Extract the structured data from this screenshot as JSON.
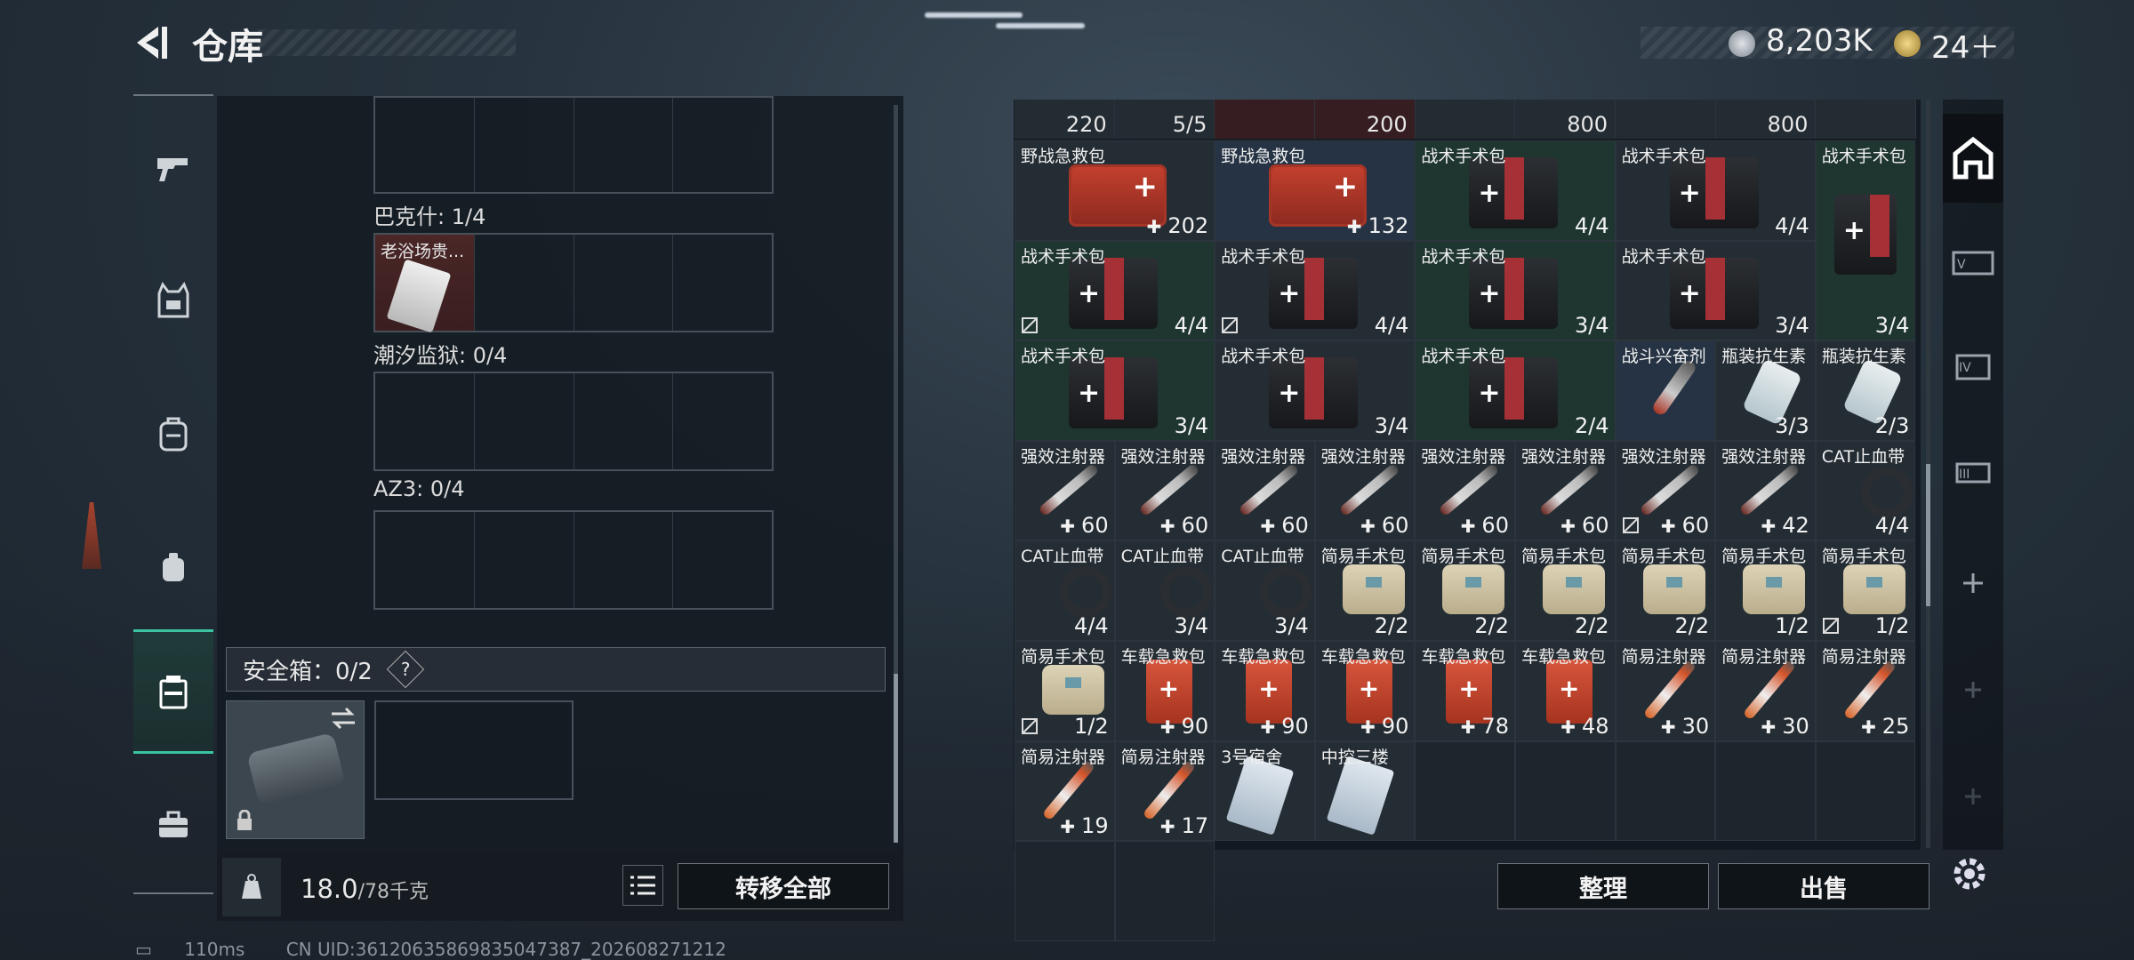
{
  "header": {
    "title": "仓库",
    "currency": "8,203K",
    "tokens": "24＋"
  },
  "left_tabs": [
    "pistol-icon",
    "vest-icon",
    "backpack-icon",
    "pouch-icon",
    "safebox-icon",
    "toolbox-icon"
  ],
  "left_sections": [
    {
      "label": "巴克什: 1/4",
      "slot_item": "老浴场贵..."
    },
    {
      "label": "潮汐监狱: 0/4"
    },
    {
      "label": "AZ3: 0/4"
    }
  ],
  "safebox": {
    "label": "安全箱：0/2",
    "help": "?"
  },
  "footer": {
    "weight": "18.0",
    "weight_max": "/78千克",
    "transfer_all": "转移全部"
  },
  "right_toprow": [
    {
      "value": "220"
    },
    {
      "value": "5/5"
    },
    {
      "value": ""
    },
    {
      "value": "200"
    },
    {
      "value": ""
    },
    {
      "value": "800"
    },
    {
      "value": ""
    },
    {
      "value": "800"
    },
    {
      "value": ""
    }
  ],
  "right_buttons": {
    "sort": "整理",
    "sell": "出售"
  },
  "status_bar": {
    "ping": "110ms",
    "uid": "CN UID:36120635869835047387_202608271212"
  },
  "inventory": [
    {
      "name": "野战急救包",
      "qty": "202",
      "type": "kit-red",
      "plus": true,
      "span": 2,
      "bg": "c-dark"
    },
    {
      "name": "野战急救包",
      "qty": "132",
      "type": "kit-red",
      "plus": true,
      "span": 2,
      "bg": "c-blue"
    },
    {
      "name": "战术手术包",
      "qty": "4/4",
      "type": "kit-black",
      "span": 2,
      "bg": "c-green"
    },
    {
      "name": "战术手术包",
      "qty": "4/4",
      "type": "kit-black",
      "span": 2,
      "bg": "c-dark"
    },
    {
      "name": "战术手术包",
      "qty": "3/4",
      "type": "kit-black",
      "span": 1,
      "rows": 2,
      "bg": "c-green"
    },
    {
      "name": "战术手术包",
      "qty": "4/4",
      "type": "kit-black",
      "lock": true,
      "span": 2,
      "bg": "c-green"
    },
    {
      "name": "战术手术包",
      "qty": "4/4",
      "type": "kit-black",
      "lock": true,
      "span": 2,
      "bg": "c-dark"
    },
    {
      "name": "战术手术包",
      "qty": "3/4",
      "type": "kit-black",
      "span": 2,
      "bg": "c-green"
    },
    {
      "name": "战术手术包",
      "qty": "3/4",
      "type": "kit-black",
      "span": 2,
      "bg": "c-dark"
    },
    {
      "name": "战术手术包",
      "qty": "3/4",
      "type": "kit-black",
      "span": 2,
      "bg": "c-green"
    },
    {
      "name": "战术手术包",
      "qty": "3/4",
      "type": "kit-black",
      "span": 2,
      "bg": "c-dark"
    },
    {
      "name": "战术手术包",
      "qty": "2/4",
      "type": "kit-black",
      "span": 2,
      "bg": "c-green"
    },
    {
      "name": "战斗兴奋剂",
      "qty": "",
      "type": "pen",
      "span": 1,
      "bg": "c-blue"
    },
    {
      "name": "瓶装抗生素",
      "qty": "3/3",
      "type": "bottle",
      "span": 1,
      "bg": "c-dark"
    },
    {
      "name": "瓶装抗生素",
      "qty": "2/3",
      "type": "bottle",
      "span": 1,
      "bg": "c-dark"
    },
    {
      "name": "强效注射器",
      "qty": "60",
      "type": "injector",
      "plus": true,
      "bg": "c-dark"
    },
    {
      "name": "强效注射器",
      "qty": "60",
      "type": "injector",
      "plus": true,
      "bg": "c-dark"
    },
    {
      "name": "强效注射器",
      "qty": "60",
      "type": "injector",
      "plus": true,
      "bg": "c-dark"
    },
    {
      "name": "强效注射器",
      "qty": "60",
      "type": "injector",
      "plus": true,
      "bg": "c-dark"
    },
    {
      "name": "强效注射器",
      "qty": "60",
      "type": "injector",
      "plus": true,
      "bg": "c-dark"
    },
    {
      "name": "强效注射器",
      "qty": "60",
      "type": "injector",
      "plus": true,
      "bg": "c-dark"
    },
    {
      "name": "强效注射器",
      "qty": "60",
      "type": "injector",
      "plus": true,
      "lock": true,
      "bg": "c-dark"
    },
    {
      "name": "强效注射器",
      "qty": "42",
      "type": "injector",
      "plus": true,
      "bg": "c-dark"
    },
    {
      "name": "CAT止血带",
      "qty": "4/4",
      "type": "tq",
      "bg": "c-dark"
    },
    {
      "name": "CAT止血带",
      "qty": "4/4",
      "type": "tq",
      "bg": "c-dark"
    },
    {
      "name": "CAT止血带",
      "qty": "3/4",
      "type": "tq",
      "bg": "c-dark"
    },
    {
      "name": "CAT止血带",
      "qty": "3/4",
      "type": "tq",
      "bg": "c-dark"
    },
    {
      "name": "简易手术包",
      "qty": "2/2",
      "type": "pouch",
      "bg": "c-dark"
    },
    {
      "name": "简易手术包",
      "qty": "2/2",
      "type": "pouch",
      "bg": "c-dark"
    },
    {
      "name": "简易手术包",
      "qty": "2/2",
      "type": "pouch",
      "bg": "c-dark"
    },
    {
      "name": "简易手术包",
      "qty": "2/2",
      "type": "pouch",
      "bg": "c-dark"
    },
    {
      "name": "简易手术包",
      "qty": "1/2",
      "type": "pouch",
      "bg": "c-dark"
    },
    {
      "name": "简易手术包",
      "qty": "1/2",
      "type": "pouch",
      "lock": true,
      "bg": "c-dark"
    },
    {
      "name": "简易手术包",
      "qty": "1/2",
      "type": "pouch",
      "lock": true,
      "bg": "c-dark"
    },
    {
      "name": "车载急救包",
      "qty": "90",
      "type": "redbag",
      "plus": true,
      "bg": "c-dark"
    },
    {
      "name": "车载急救包",
      "qty": "90",
      "type": "redbag",
      "plus": true,
      "bg": "c-dark"
    },
    {
      "name": "车载急救包",
      "qty": "90",
      "type": "redbag",
      "plus": true,
      "bg": "c-dark"
    },
    {
      "name": "车载急救包",
      "qty": "78",
      "type": "redbag",
      "plus": true,
      "bg": "c-dark"
    },
    {
      "name": "车载急救包",
      "qty": "48",
      "type": "redbag",
      "plus": true,
      "bg": "c-dark"
    },
    {
      "name": "简易注射器",
      "qty": "30",
      "type": "injector2",
      "plus": true,
      "bg": "c-dark"
    },
    {
      "name": "简易注射器",
      "qty": "30",
      "type": "injector2",
      "plus": true,
      "bg": "c-dark"
    },
    {
      "name": "简易注射器",
      "qty": "25",
      "type": "injector2",
      "plus": true,
      "bg": "c-dark"
    },
    {
      "name": "简易注射器",
      "qty": "19",
      "type": "injector2",
      "plus": true,
      "bg": "c-dark"
    },
    {
      "name": "简易注射器",
      "qty": "17",
      "type": "injector2",
      "plus": true,
      "bg": "c-dark"
    },
    {
      "name": "3号宿舍",
      "qty": "",
      "type": "card",
      "bg": "c-dark"
    },
    {
      "name": "中控三楼",
      "qty": "",
      "type": "card",
      "bg": "c-dark"
    }
  ],
  "right_tabs": [
    "home-icon",
    "weapon-parts-icon",
    "armor-icon",
    "gear-icon",
    "add-icon",
    "slot-icon",
    "slot2-icon"
  ]
}
